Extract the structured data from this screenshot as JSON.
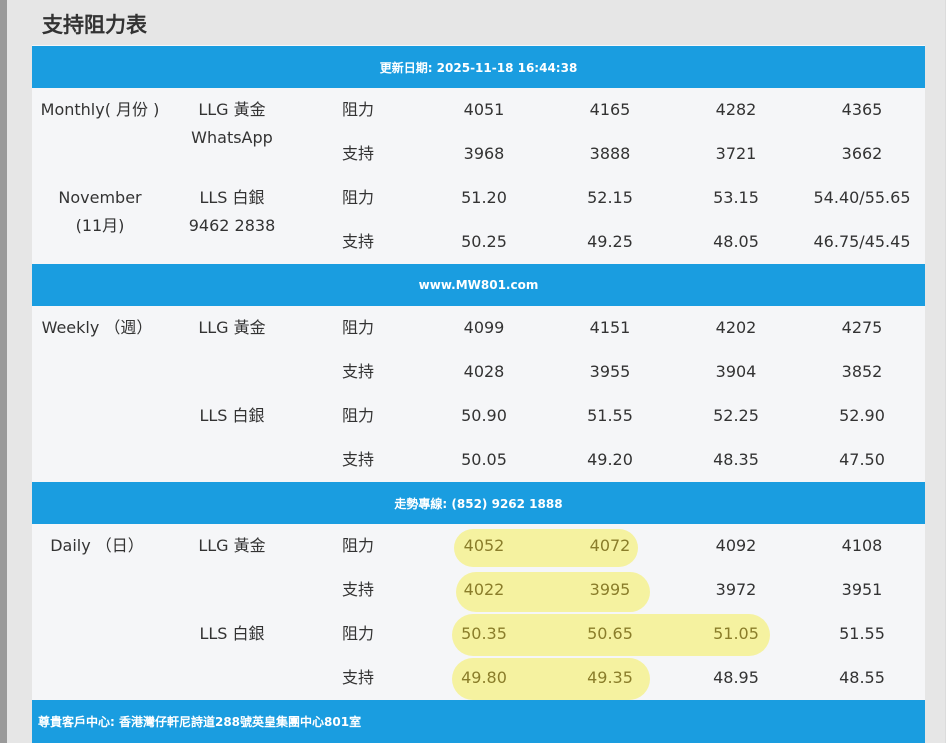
{
  "page_title": "支持阻力表",
  "banners": {
    "update": "更新日期: 2025-11-18 16:44:38",
    "site": "www.MW801.com",
    "hotline": "走勢專線: (852) 9262 1888",
    "address": "尊貴客戶中心: 香港灣仔軒尼詩道288號英皇集團中心801室"
  },
  "monthly": {
    "period_label": "Monthly( 月份 )",
    "month_label": "November",
    "month_label_cn": "(11月)",
    "gold": {
      "name": "LLG 黃金",
      "sub": "WhatsApp",
      "resistance_label": "阻力",
      "support_label": "支持",
      "resistance": [
        "4051",
        "4165",
        "4282",
        "4365"
      ],
      "support": [
        "3968",
        "3888",
        "3721",
        "3662"
      ]
    },
    "silver": {
      "name": "LLS 白銀",
      "sub": "9462 2838",
      "resistance_label": "阻力",
      "support_label": "支持",
      "resistance": [
        "51.20",
        "52.15",
        "53.15",
        "54.40/55.65"
      ],
      "support": [
        "50.25",
        "49.25",
        "48.05",
        "46.75/45.45"
      ]
    }
  },
  "weekly": {
    "period_label": "Weekly （週）",
    "gold": {
      "name": "LLG 黃金",
      "resistance_label": "阻力",
      "support_label": "支持",
      "resistance": [
        "4099",
        "4151",
        "4202",
        "4275"
      ],
      "support": [
        "4028",
        "3955",
        "3904",
        "3852"
      ]
    },
    "silver": {
      "name": "LLS 白銀",
      "resistance_label": "阻力",
      "support_label": "支持",
      "resistance": [
        "50.90",
        "51.55",
        "52.25",
        "52.90"
      ],
      "support": [
        "50.05",
        "49.20",
        "48.35",
        "47.50"
      ]
    }
  },
  "daily": {
    "period_label": "Daily （日）",
    "gold": {
      "name": "LLG 黃金",
      "resistance_label": "阻力",
      "support_label": "支持",
      "resistance": [
        "4052",
        "4072",
        "4092",
        "4108"
      ],
      "support": [
        "4022",
        "3995",
        "3972",
        "3951"
      ]
    },
    "silver": {
      "name": "LLS 白銀",
      "resistance_label": "阻力",
      "support_label": "支持",
      "resistance": [
        "50.35",
        "50.65",
        "51.05",
        "51.55"
      ],
      "support": [
        "49.80",
        "49.35",
        "48.95",
        "48.55"
      ]
    }
  },
  "colors": {
    "banner": "#1a9de0",
    "highlight": "#f4f190",
    "text": "#333333"
  }
}
